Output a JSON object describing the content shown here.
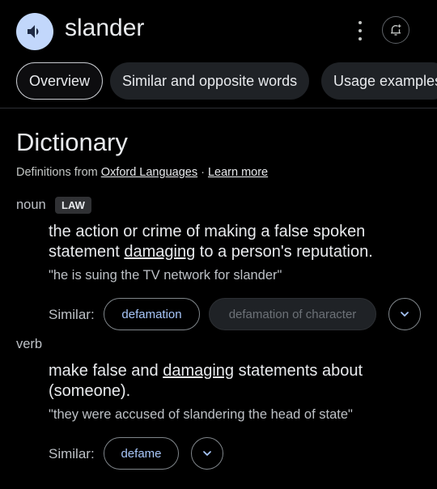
{
  "header": {
    "word": "slander",
    "icons": {
      "speaker": "speaker-icon",
      "menu": "more-vert-icon",
      "alert": "bell-add-icon"
    }
  },
  "tabs": [
    {
      "label": "Overview",
      "active": true
    },
    {
      "label": "Similar and opposite words",
      "active": false
    },
    {
      "label": "Usage examples",
      "active": false
    }
  ],
  "dictionary": {
    "heading": "Dictionary",
    "source_prefix": "Definitions from ",
    "source_name": "Oxford Languages",
    "separator": " · ",
    "learn_more": "Learn more"
  },
  "senses": [
    {
      "pos": "noun",
      "label": "LAW",
      "definition_parts": [
        "the action or crime of making a false spoken statement ",
        "damaging",
        " to a person's reputation."
      ],
      "example": "\"he is suing the TV network for slander\"",
      "similar_label": "Similar:",
      "similar": [
        "defamation",
        "defamation of character"
      ]
    },
    {
      "pos": "verb",
      "definition_parts": [
        "make false and ",
        "damaging",
        " statements about (someone)."
      ],
      "example": "\"they were accused of slandering the head of state\"",
      "similar_label": "Similar:",
      "similar": [
        "defame"
      ]
    }
  ],
  "colors": {
    "background": "#000000",
    "accent_link": "#a8c7fa",
    "speaker_bg": "#c2d7fb"
  }
}
